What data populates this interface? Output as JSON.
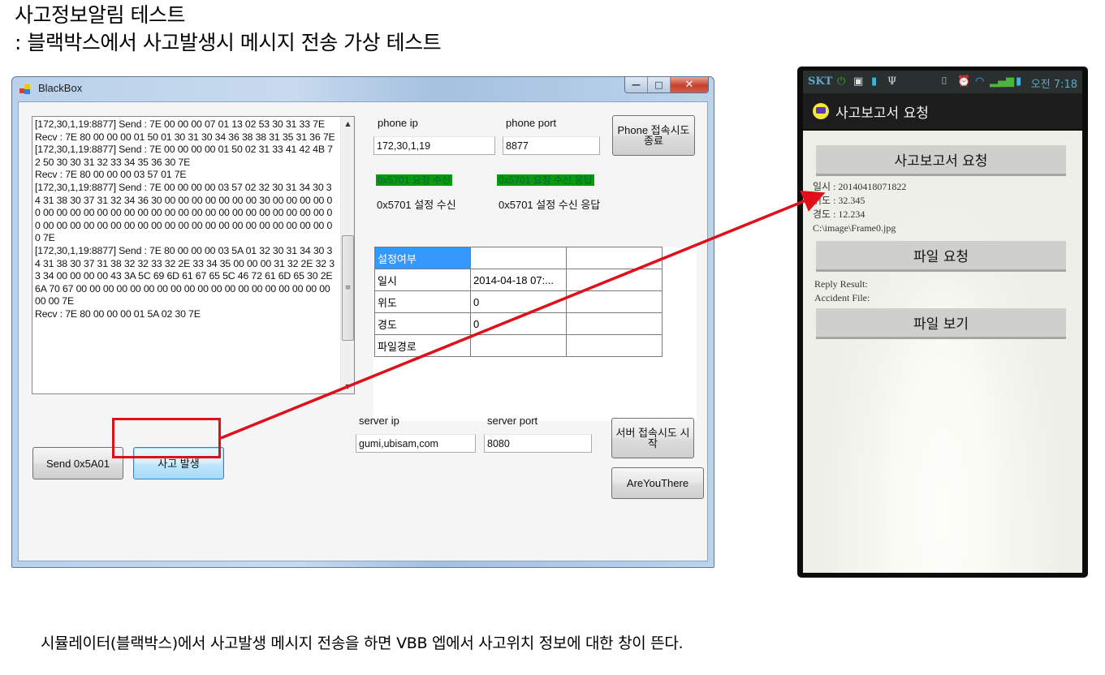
{
  "slide": {
    "title": "사고정보알림 테스트",
    "subtitle": " : 블랙박스에서 사고발생시 메시지 전송 가상 테스트",
    "caption": "시뮬레이터(블랙박스)에서 사고발생 메시지 전송을 하면 VBB 엡에서 사고위치 정보에 대한 창이 뜬다."
  },
  "window": {
    "title": "BlackBox",
    "controls": {
      "minimize": "—",
      "maximize": "□",
      "close": "✕"
    },
    "log": {
      "lines": [
        "[172,30,1,19:8877] Send : 7E 00 00 00 07 01 13 02 53 30 31 33 7E",
        "Recv : 7E 80 00 00 00 01 50 01 30 31 30 34 36 38 38 31 35 31 36 7E",
        "[172,30,1,19:8877] Send : 7E 00 00 00 00 01 50 02 31 33 41 42 4B 72 50 30 30 31 32 33 34 35 36 30 7E",
        "Recv : 7E 80 00 00 00 03 57 01 7E",
        "[172,30,1,19:8877] Send : 7E 00 00 00 00 03 57 02 32 30 31 34 30 34 31 38 30 37 31 32 34 36 30 00 00 00 00 00 00 00 30 00 00 00 00 00 00 00 00 00 00 00 00 00 00 00 00 00 00 00 00 00 00 00 00 00 00 00 00 00 00 00 00 00 00 00 00 00 00 00 00 00 00 00 00 00 00 00 00 00 7E",
        "[172,30,1,19:8877] Send : 7E 80 00 00 00 03 5A 01 32 30 31 34 30 34 31 38 30 37 31 38 32 32 33 32 2E 33 34 35 00 00 00 31 32 2E 32 33 34 00 00 00 00 43 3A 5C 69 6D 61 67 65 5C 46 72 61 6D 65 30 2E 6A 70 67 00 00 00 00 00 00 00 00 00 00 00 00 00 00 00 00 00 00 00 00 00 7E",
        "Recv : 7E 80 00 00 00 01 5A 02 30 7E"
      ],
      "scroll_position": 0.72
    },
    "phone": {
      "ip_label": "phone ip",
      "ip_value": "172,30,1,19",
      "port_label": "phone port",
      "port_value": "8877",
      "connect_button": "Phone 접속시도 종료"
    },
    "status": {
      "request_recv": "0x5701 요청 수신",
      "request_recv_ack": "0x5701 요청 수신 응답",
      "setting_recv": "0x5701 설정 수신",
      "setting_recv_ack": "0x5701 설정 수신 응답",
      "active_color": "#0a9a10"
    },
    "grid": {
      "rows": [
        [
          "설정여부",
          "",
          ""
        ],
        [
          "일시",
          "2014-04-18 07:...",
          ""
        ],
        [
          "위도",
          "0",
          ""
        ],
        [
          "경도",
          "0",
          ""
        ],
        [
          "파일경로",
          "",
          ""
        ]
      ],
      "selected_color": "#3399ff"
    },
    "buttons": {
      "send_5a01": "Send 0x5A01",
      "accident": "사고 발생",
      "server_connect": "서버 접속시도 시작",
      "are_you_there": "AreYouThere"
    },
    "server": {
      "ip_label": "server ip",
      "ip_value": "gumi,ubisam,com",
      "port_label": "server port",
      "port_value": "8080"
    }
  },
  "phone_app": {
    "status_bar": {
      "carrier": "SKT",
      "time": "오전 7:18"
    },
    "app_title": "사고보고서 요청",
    "report_button": "사고보고서 요청",
    "datetime": "일시 : 20140418071822",
    "latitude": "위도 : 32.345",
    "longitude": "경도 : 12.234",
    "file_path": "C:\\image\\Frame0.jpg",
    "file_request_button": "파일 요청",
    "reply_result": "Reply Result:",
    "accident_file": "Accident File:",
    "file_view_button": "파일 보기"
  },
  "annotation": {
    "color": "#e0101a"
  }
}
